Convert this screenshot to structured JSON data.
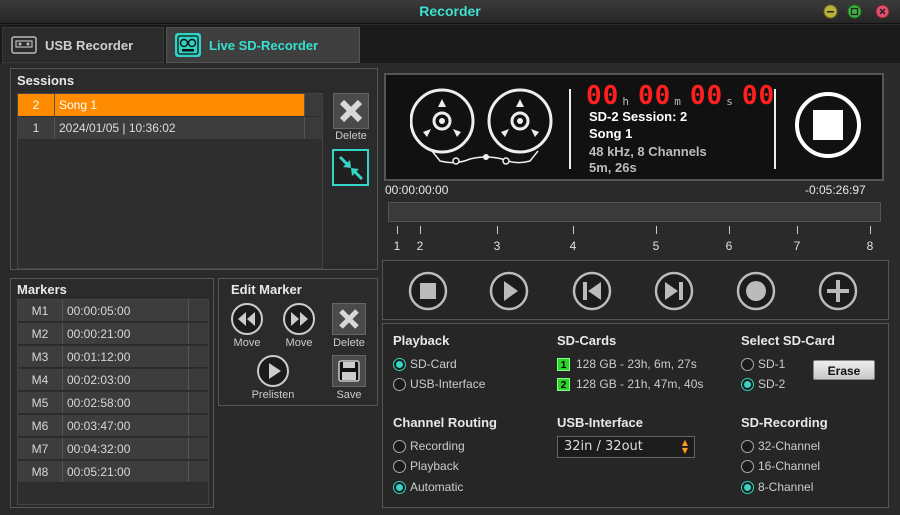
{
  "window": {
    "title": "Recorder"
  },
  "tabs": [
    {
      "label": "USB Recorder",
      "active": false
    },
    {
      "label": "Live SD-Recorder",
      "active": true
    }
  ],
  "sessions": {
    "title": "Sessions",
    "rows": [
      {
        "num": "2",
        "name": "Song 1",
        "selected": true
      },
      {
        "num": "1",
        "name": "2024/01/05 | 10:36:02",
        "selected": false
      }
    ],
    "delete_label": "Delete"
  },
  "markers": {
    "title": "Markers",
    "rows": [
      {
        "id": "M1",
        "time": "00:00:05:00"
      },
      {
        "id": "M2",
        "time": "00:00:21:00"
      },
      {
        "id": "M3",
        "time": "00:01:12:00"
      },
      {
        "id": "M4",
        "time": "00:02:03:00"
      },
      {
        "id": "M5",
        "time": "00:02:58:00"
      },
      {
        "id": "M6",
        "time": "00:03:47:00"
      },
      {
        "id": "M7",
        "time": "00:04:32:00"
      },
      {
        "id": "M8",
        "time": "00:05:21:00"
      }
    ]
  },
  "edit_marker": {
    "title": "Edit Marker",
    "move_back_label": "Move",
    "move_forward_label": "Move",
    "delete_label": "Delete",
    "prelisten_label": "Prelisten",
    "save_label": "Save"
  },
  "display": {
    "counter": {
      "h": "00",
      "m": "00",
      "s": "00",
      "f": "00"
    },
    "units": {
      "h": "h",
      "m": "m",
      "s": "s"
    },
    "session_line": "SD-2 Session: 2",
    "song": "Song 1",
    "format": "48 kHz,  8 Channels",
    "duration": "5m, 26s"
  },
  "timeline": {
    "position": "00:00:00:00",
    "remaining": "-0:05:26:97",
    "progress_fraction": 0,
    "marker_labels": [
      "1",
      "2",
      "3",
      "4",
      "5",
      "6",
      "7",
      "8"
    ]
  },
  "transport": [
    "stop-button",
    "play-button",
    "previous-button",
    "next-button",
    "record-button",
    "add-marker-button"
  ],
  "settings": {
    "playback": {
      "title": "Playback",
      "options": [
        {
          "label": "SD-Card",
          "checked": true
        },
        {
          "label": "USB-Interface",
          "checked": false
        }
      ]
    },
    "sd_cards": {
      "title": "SD-Cards",
      "cards": [
        {
          "badge": "1",
          "text": "128 GB - 23h,  6m, 27s"
        },
        {
          "badge": "2",
          "text": "128 GB - 21h, 47m, 40s"
        }
      ]
    },
    "select_sd_card": {
      "title": "Select SD-Card",
      "options": [
        {
          "label": "SD-1",
          "checked": false
        },
        {
          "label": "SD-2",
          "checked": true
        }
      ],
      "erase_label": "Erase"
    },
    "channel_routing": {
      "title": "Channel Routing",
      "options": [
        {
          "label": "Recording",
          "checked": false
        },
        {
          "label": "Playback",
          "checked": false
        },
        {
          "label": "Automatic",
          "checked": true
        }
      ]
    },
    "usb_interface": {
      "title": "USB-Interface",
      "value": "32in / 32out"
    },
    "sd_recording": {
      "title": "SD-Recording",
      "options": [
        {
          "label": "32-Channel",
          "checked": false
        },
        {
          "label": "16-Channel",
          "checked": false
        },
        {
          "label": "8-Channel",
          "checked": true
        }
      ]
    }
  },
  "colors": {
    "accent": "#33d6c6",
    "selection": "#ff8c00",
    "counter": "#ff1f1f",
    "card_badge": "#2bd42b"
  }
}
